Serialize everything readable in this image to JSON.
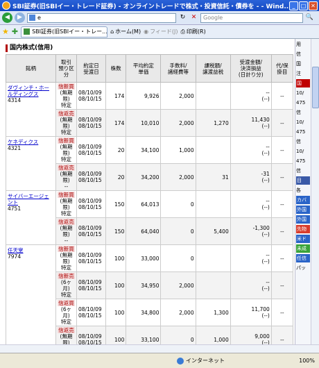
{
  "window": {
    "title": "SBI証券(旧SBIイー・トレード証券) - オンライントレードで株式・投資信託・債券を - - Wind...",
    "minimize": "_",
    "maximize": "□",
    "close": "✕"
  },
  "navbar": {
    "back": "◀",
    "forward": "▶",
    "address": "e",
    "refresh": "↻",
    "stop": "✕",
    "search_placeholder": "Google",
    "search_go": "🔍"
  },
  "tabbar": {
    "tab_label": "SBI証券(旧SBIイー・トレー...",
    "home_label": "ホーム(M)",
    "feed_label": "フィード(J)",
    "print_label": "印刷(R)"
  },
  "section_title": "国内株式(信用)",
  "table": {
    "headers": [
      "銘柄",
      "取引\n預り区\n分",
      "約定日\n受渡日",
      "株数",
      "平均約定\n単価",
      "手数料/\n諸経費等",
      "課税額/\n譲渡益税",
      "受渡金額/\n決済損益\n(日計り分)",
      "代/保\n掛目"
    ],
    "groups": [
      {
        "name": "ダヴィンチ・ホールディングス",
        "code": "4314",
        "rows": [
          {
            "type": "信新買",
            "term": "(無期限)",
            "account": "特定",
            "date1": "08/10/09",
            "date2": "08/10/15",
            "qty": "174",
            "price": "9,926",
            "fee": "2,000",
            "tax": "",
            "amount": "--",
            "sub": "(--)",
            "ratio": "--"
          },
          {
            "type": "信返売",
            "term": "(無期限)",
            "account": "特定",
            "date1": "08/10/09",
            "date2": "08/10/15",
            "qty": "174",
            "price": "10,010",
            "fee": "2,000",
            "tax": "1,270",
            "amount": "11,430",
            "sub": "(--)",
            "ratio": "--"
          }
        ]
      },
      {
        "name": "ケネディクス",
        "code": "4321",
        "rows": [
          {
            "type": "信新買",
            "term": "(無期限)",
            "account": "特定",
            "date1": "08/10/09",
            "date2": "08/10/15",
            "qty": "20",
            "price": "34,100",
            "fee": "1,000",
            "tax": "",
            "amount": "--",
            "sub": "(--)",
            "ratio": "--"
          },
          {
            "type": "信返売",
            "term": "(無期限)",
            "account": "--",
            "date1": "08/10/09",
            "date2": "08/10/15",
            "qty": "20",
            "price": "34,200",
            "fee": "2,000",
            "tax": "31",
            "amount": "-31",
            "sub": "(--)",
            "ratio": "--"
          }
        ]
      },
      {
        "name": "サイバーエージェント",
        "code": "4751",
        "rows": [
          {
            "type": "信新買",
            "term": "(無期限)",
            "account": "特定",
            "date1": "08/10/09",
            "date2": "08/10/15",
            "qty": "150",
            "price": "64,013",
            "fee": "0",
            "tax": "",
            "amount": "--",
            "sub": "(--)",
            "ratio": "--"
          },
          {
            "type": "信返売",
            "term": "(無期限)",
            "account": "--",
            "date1": "08/10/09",
            "date2": "08/10/15",
            "qty": "150",
            "price": "64,040",
            "fee": "0",
            "tax": "5,400",
            "amount": "-1,300",
            "sub": "(--)",
            "ratio": "--"
          }
        ]
      },
      {
        "name": "任天堂",
        "code": "7974",
        "rows": [
          {
            "type": "信新買",
            "term": "(無期限)",
            "account": "特定",
            "date1": "08/10/09",
            "date2": "08/10/15",
            "qty": "100",
            "price": "33,000",
            "fee": "0",
            "tax": "",
            "amount": "--",
            "sub": "(--)",
            "ratio": "--"
          },
          {
            "type": "信新売",
            "term": "(6ヶ月)",
            "account": "特定",
            "date1": "08/10/09",
            "date2": "08/10/15",
            "qty": "100",
            "price": "34,950",
            "fee": "2,000",
            "tax": "",
            "amount": "--",
            "sub": "(--)",
            "ratio": "--"
          },
          {
            "type": "信返買",
            "term": "(6ヶ月)",
            "account": "特定",
            "date1": "08/10/09",
            "date2": "08/10/15",
            "qty": "100",
            "price": "34,800",
            "fee": "2,000",
            "tax": "1,300",
            "amount": "11,700",
            "sub": "(--)",
            "ratio": "--"
          },
          {
            "type": "信返売",
            "term": "(無期限)",
            "account": "--",
            "date1": "08/10/09",
            "date2": "08/10/15",
            "qty": "100",
            "price": "33,100",
            "fee": "0",
            "tax": "1,000",
            "amount": "9,000",
            "sub": "(--)",
            "ratio": "--"
          }
        ]
      }
    ]
  },
  "sidepane": {
    "items": [
      {
        "label": "用",
        "color": ""
      },
      {
        "label": "信",
        "color": ""
      },
      {
        "label": "国",
        "color": ""
      },
      {
        "label": "注",
        "color": ""
      },
      {
        "label": "国",
        "color": "#c00000"
      },
      {
        "label": "10/",
        "color": ""
      },
      {
        "label": "475",
        "color": ""
      },
      {
        "label": "信",
        "color": ""
      },
      {
        "label": "10/",
        "color": ""
      },
      {
        "label": "475",
        "color": ""
      },
      {
        "label": "信",
        "color": ""
      },
      {
        "label": "10/",
        "color": ""
      },
      {
        "label": "475",
        "color": ""
      },
      {
        "label": "信",
        "color": ""
      },
      {
        "label": "目",
        "color": "#3a5aa8"
      },
      {
        "label": "各",
        "color": ""
      },
      {
        "label": "カバ",
        "color": "#2a64c8"
      },
      {
        "label": "外国",
        "color": "#2a64c8"
      },
      {
        "label": "外国",
        "color": "#2a64c8"
      },
      {
        "label": "先物",
        "color": "#d83c2c"
      },
      {
        "label": "米ド",
        "color": "#2a64c8"
      },
      {
        "label": "未成",
        "color": "#3aa33a"
      },
      {
        "label": "任信",
        "color": "#2a64c8"
      },
      {
        "label": "パッ",
        "color": ""
      }
    ]
  },
  "status": {
    "zone": "インターネット",
    "zoom": "100%"
  },
  "colors": {
    "link": "#0000cc",
    "title_gradient": "#1448c2",
    "accent": "#b10000"
  }
}
